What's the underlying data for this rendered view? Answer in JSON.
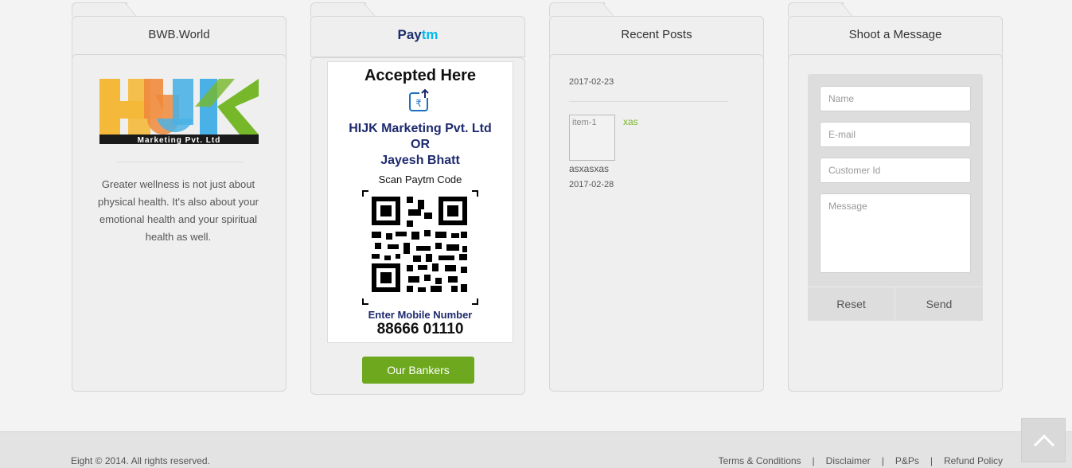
{
  "colors": {
    "accent_green": "#6ea81e",
    "link_green": "#7cb52a",
    "paytm_navy": "#1d2f6b",
    "paytm_cyan": "#00b9f1"
  },
  "widgets": {
    "about": {
      "title": "BWB.World",
      "logo_text": "HIJK",
      "logo_sub": "Marketing Pvt. Ltd",
      "text": "Greater wellness is not just about physical health. It's also about your emotional health and your spiritual health as well."
    },
    "paytm": {
      "logo_a": "Pay",
      "logo_b": "tm",
      "card_title": "Accepted Here",
      "name_line1": "HIJK Marketing Pvt. Ltd",
      "name_line2": "OR",
      "name_line3": "Jayesh Bhatt",
      "scan_text": "Scan Paytm Code",
      "enter_text": "Enter Mobile Number",
      "mobile_number": "88666 01110",
      "button_label": "Our Bankers"
    },
    "recent_posts": {
      "title": "Recent Posts",
      "top_date": "2017-02-23",
      "post": {
        "thumb_alt": "item-1",
        "link": "xas",
        "excerpt": "asxasxas",
        "date": "2017-02-28"
      }
    },
    "message": {
      "title": "Shoot a Message",
      "name_placeholder": "Name",
      "email_placeholder": "E-mail",
      "customer_placeholder": "Customer Id",
      "message_placeholder": "Message",
      "reset_label": "Reset",
      "send_label": "Send"
    }
  },
  "footer": {
    "copyright": "Eight © 2014. All rights reserved.",
    "links": [
      "Terms & Conditions",
      "Disclaimer",
      "P&Ps",
      "Refund Policy"
    ],
    "separator": "|"
  },
  "icons": {
    "back_to_top": "chevron-up-icon",
    "upload": "rupee-upload-icon"
  }
}
